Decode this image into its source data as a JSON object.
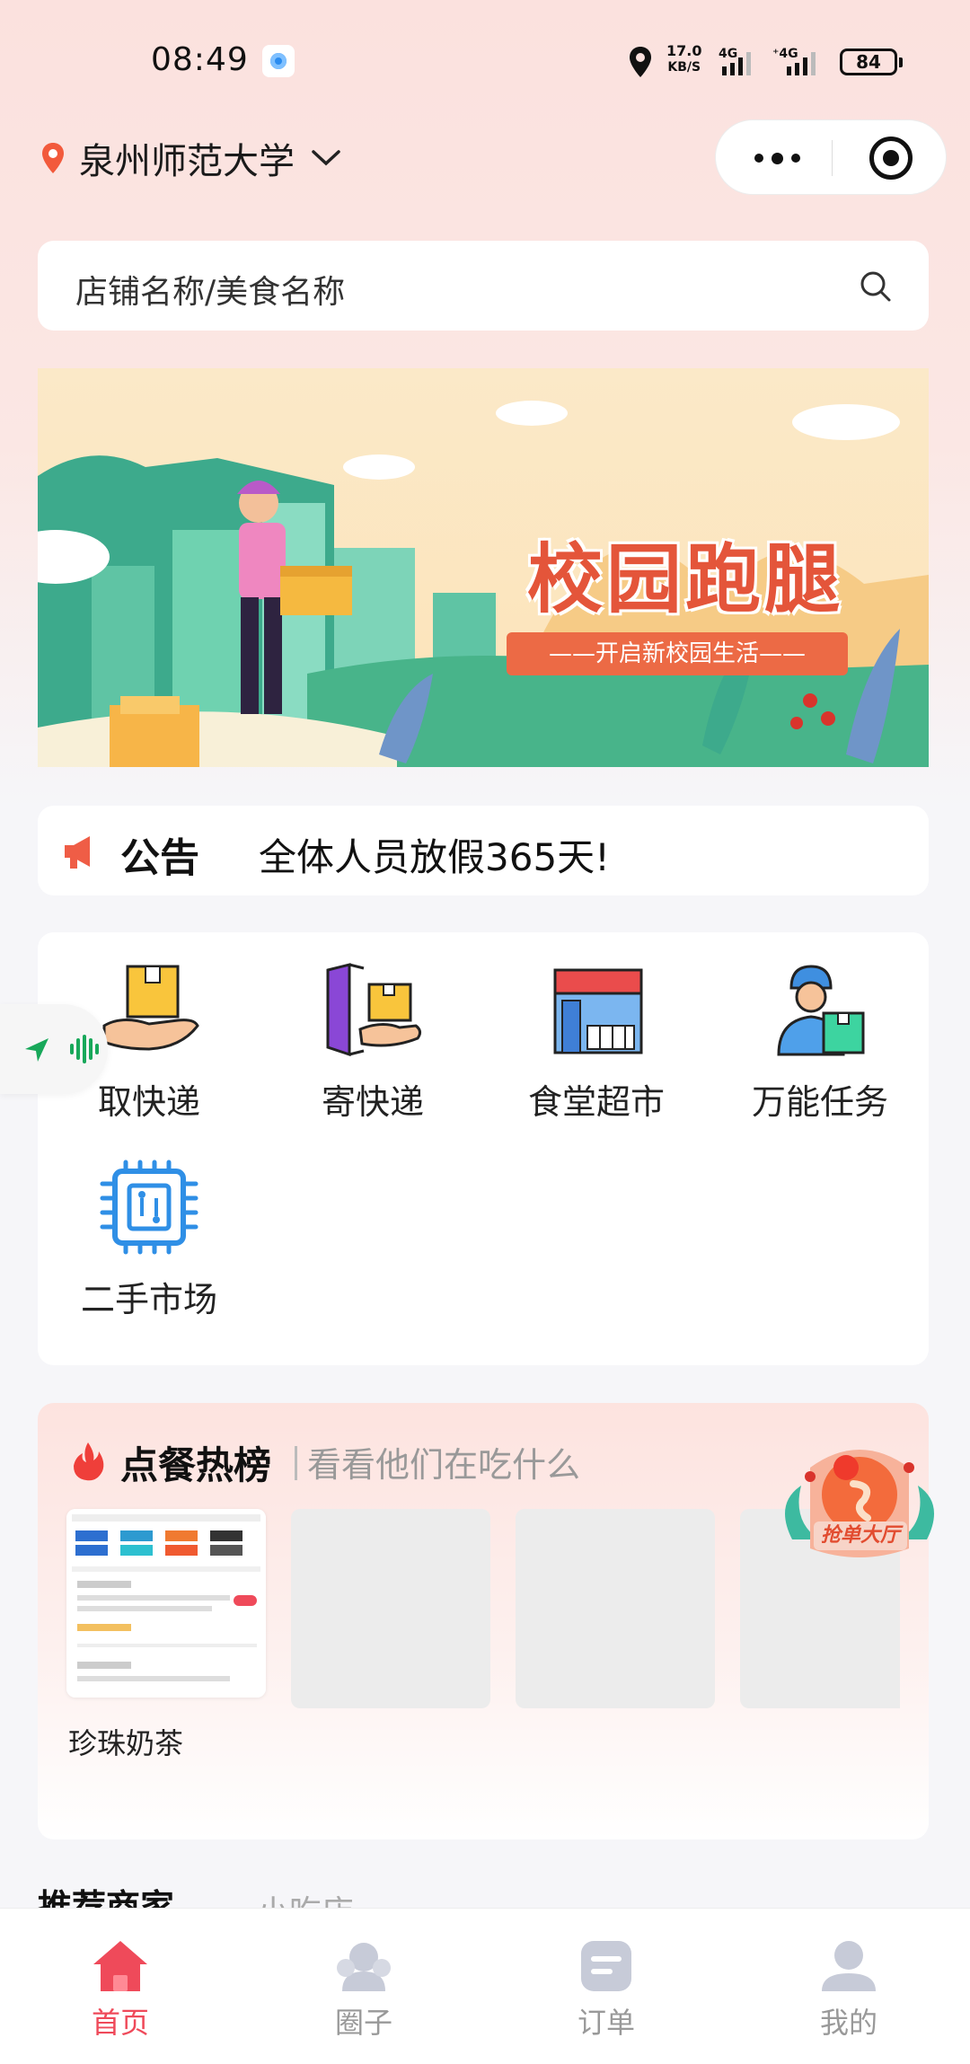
{
  "status_bar": {
    "time": "08:49",
    "net_speed": "17.0",
    "net_unit": "KB/S",
    "net_type_1": "4G",
    "net_type_2": "4G",
    "battery": "84"
  },
  "header": {
    "location": "泉州师范大学"
  },
  "search": {
    "placeholder": "店铺名称/美食名称"
  },
  "banner": {
    "title": "校园跑腿",
    "subtitle": "——开启新校园生活——"
  },
  "notice": {
    "tag": "公告",
    "text": "全体人员放假365天!"
  },
  "services": [
    {
      "label": "取快递",
      "icon": "pickup-package-icon"
    },
    {
      "label": "寄快递",
      "icon": "send-package-icon"
    },
    {
      "label": "食堂超市",
      "icon": "canteen-store-icon"
    },
    {
      "label": "万能任务",
      "icon": "courier-task-icon"
    },
    {
      "label": "二手市场",
      "icon": "chip-market-icon"
    }
  ],
  "hot_list": {
    "title": "点餐热榜",
    "subtitle": "看看他们在吃什么",
    "items": [
      {
        "name": "珍珠奶茶"
      }
    ],
    "grab_badge": "抢单大厅"
  },
  "recommended": {
    "title": "推荐商家",
    "tab": "小吃店"
  },
  "tabbar": [
    {
      "label": "首页",
      "icon": "home-icon",
      "active": true
    },
    {
      "label": "圈子",
      "icon": "community-icon",
      "active": false
    },
    {
      "label": "订单",
      "icon": "order-icon",
      "active": false
    },
    {
      "label": "我的",
      "icon": "profile-icon",
      "active": false
    }
  ],
  "colors": {
    "accent": "#ef4a5a",
    "banner_red": "#e4553a",
    "page_bg": "#f6f6f9",
    "top_gradient": "#fbe1de"
  }
}
